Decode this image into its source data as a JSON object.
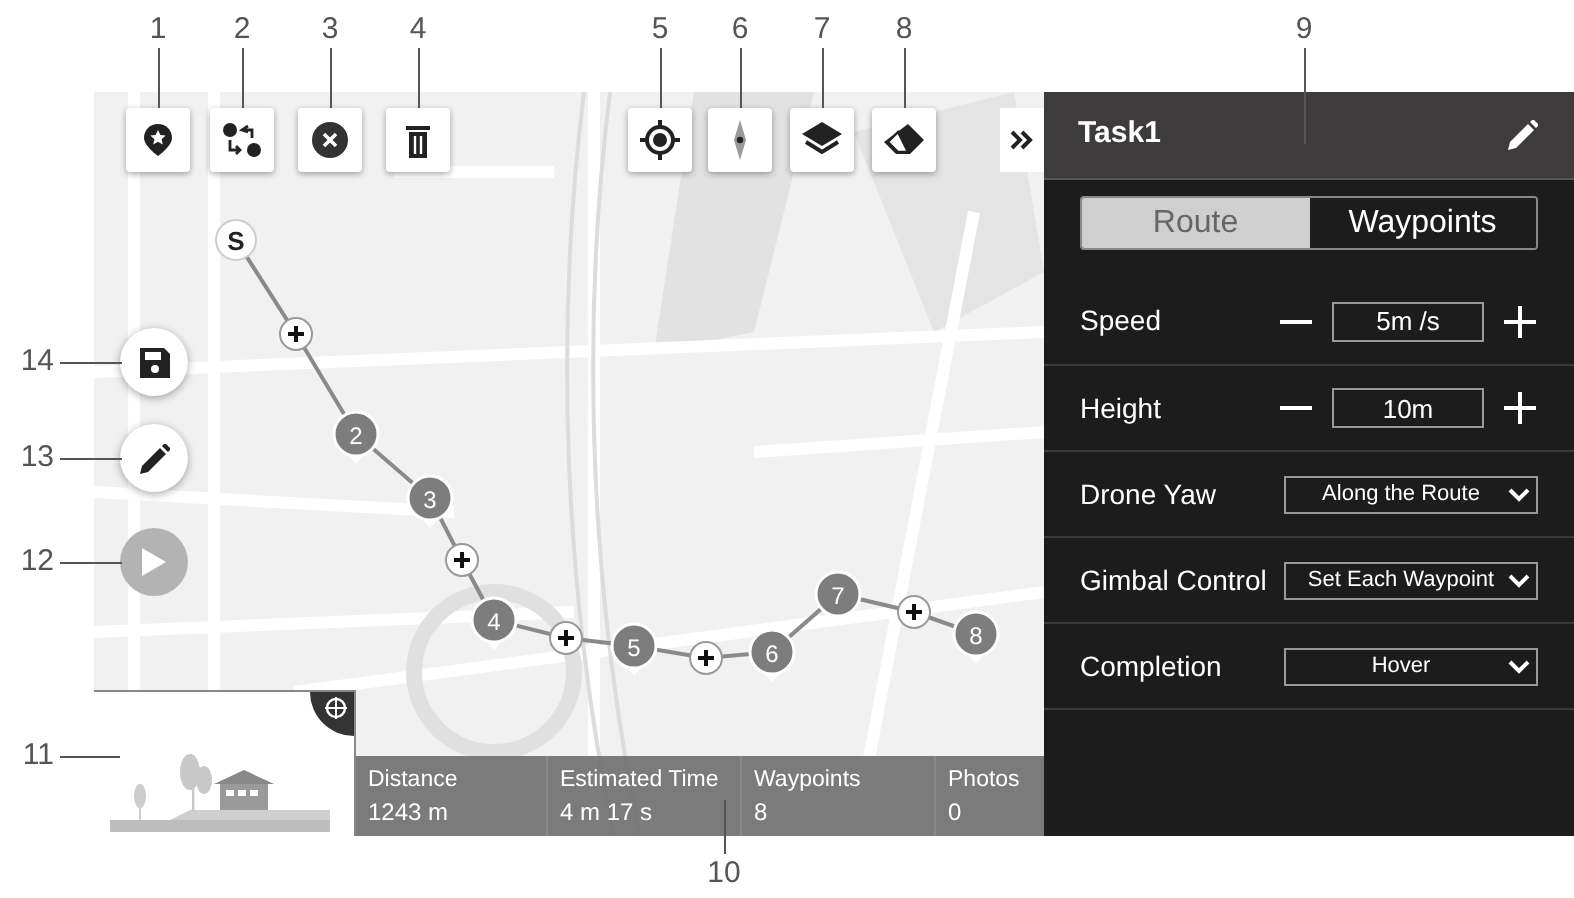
{
  "callouts": [
    {
      "label": "1"
    },
    {
      "label": "2"
    },
    {
      "label": "3"
    },
    {
      "label": "4"
    },
    {
      "label": "5"
    },
    {
      "label": "6"
    },
    {
      "label": "7"
    },
    {
      "label": "8"
    },
    {
      "label": "9"
    },
    {
      "label": "14"
    },
    {
      "label": "13"
    },
    {
      "label": "12"
    },
    {
      "label": "11"
    },
    {
      "label": "10"
    }
  ],
  "map": {
    "play_disabled": true,
    "route": [
      {
        "kind": "start",
        "label": "S"
      },
      {
        "kind": "add"
      },
      {
        "kind": "waypoint",
        "label": "2"
      },
      {
        "kind": "waypoint",
        "label": "3"
      },
      {
        "kind": "add"
      },
      {
        "kind": "waypoint",
        "label": "4"
      },
      {
        "kind": "add"
      },
      {
        "kind": "waypoint",
        "label": "5"
      },
      {
        "kind": "add"
      },
      {
        "kind": "waypoint",
        "label": "6"
      },
      {
        "kind": "waypoint",
        "label": "7"
      },
      {
        "kind": "add"
      },
      {
        "kind": "waypoint",
        "label": "8"
      }
    ],
    "stats": [
      {
        "label": "Distance",
        "value": "1243 m"
      },
      {
        "label": "Estimated Time",
        "value": "4 m 17 s"
      },
      {
        "label": "Waypoints",
        "value": "8"
      },
      {
        "label": "Photos",
        "value": "0"
      }
    ]
  },
  "panel": {
    "title": "Task1",
    "tabs": [
      {
        "label": "Route",
        "selected": true
      },
      {
        "label": "Waypoints",
        "selected": false
      }
    ],
    "settings": [
      {
        "kind": "stepper",
        "label": "Speed",
        "value": "5m /s"
      },
      {
        "kind": "stepper",
        "label": "Height",
        "value": "10m"
      },
      {
        "kind": "dropdown",
        "label": "Drone Yaw",
        "value": "Along the Route"
      },
      {
        "kind": "dropdown",
        "label": "Gimbal Control",
        "value": "Set Each Waypoint"
      },
      {
        "kind": "dropdown",
        "label": "Completion",
        "value": "Hover"
      }
    ]
  }
}
